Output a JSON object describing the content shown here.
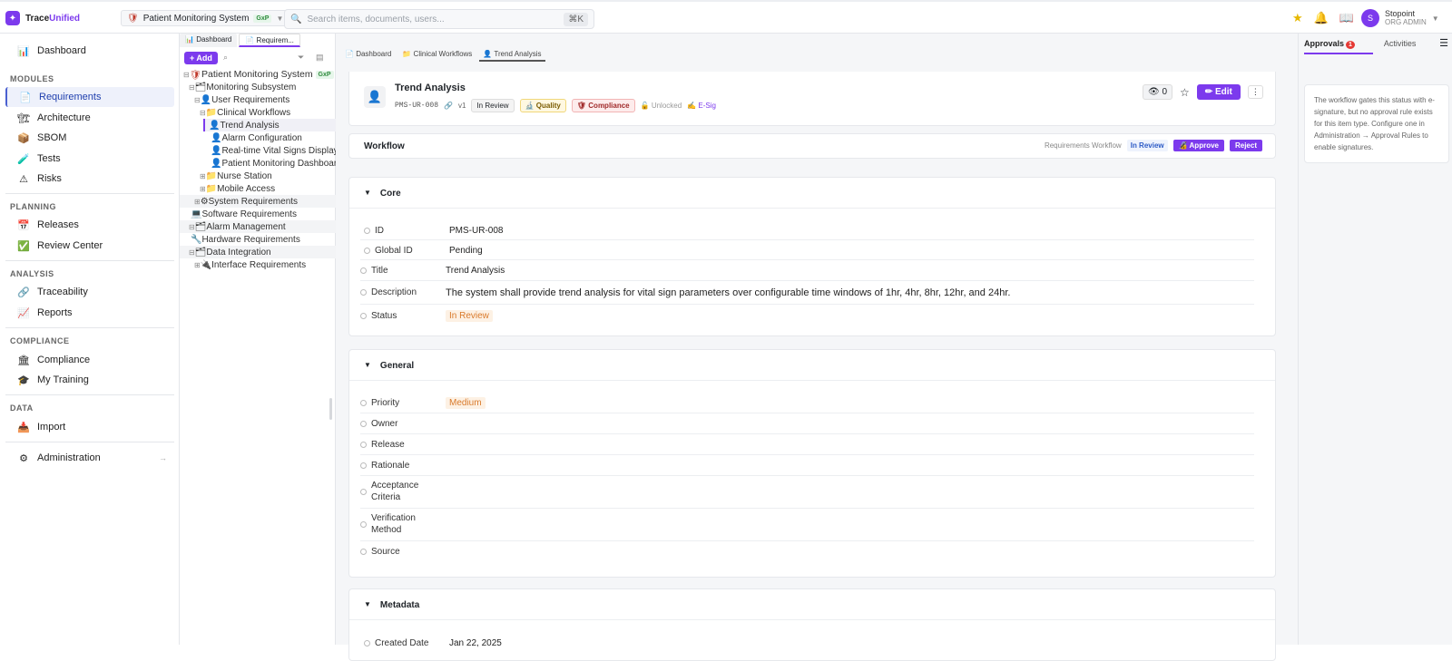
{
  "brand": {
    "name_a": "Trace",
    "name_b": "Unified"
  },
  "project": {
    "name": "Patient Monitoring System",
    "badge": "GxP"
  },
  "search": {
    "placeholder": "Search items, documents, users...",
    "shortcut": "⌘K"
  },
  "user": {
    "initial": "S",
    "name": "Stopoint",
    "role": "ORG ADMIN"
  },
  "sidebar": {
    "dashboard": "Dashboard",
    "modules_title": "MODULES",
    "modules": [
      "Requirements",
      "Architecture",
      "SBOM",
      "Tests",
      "Risks"
    ],
    "planning_title": "PLANNING",
    "planning": [
      "Releases",
      "Review Center"
    ],
    "analysis_title": "ANALYSIS",
    "analysis": [
      "Traceability",
      "Reports"
    ],
    "compliance_title": "COMPLIANCE",
    "compliance": [
      "Compliance",
      "My Training"
    ],
    "data_title": "DATA",
    "data": [
      "Import"
    ],
    "admin": "Administration"
  },
  "tree_tabs": [
    "Dashboard",
    "Requirem..."
  ],
  "tree_add": "+ Add",
  "tree": {
    "root": "Patient Monitoring System",
    "root_badge": "GxP",
    "items": [
      "Monitoring Subsystem",
      "User Requirements",
      "Clinical Workflows",
      "Trend Analysis",
      "Alarm Configuration",
      "Real-time Vital Signs Display",
      "Patient Monitoring Dashboard",
      "Nurse Station",
      "Mobile Access",
      "System Requirements",
      "Software Requirements",
      "Alarm Management",
      "Hardware Requirements",
      "Data Integration",
      "Interface Requirements"
    ]
  },
  "breadcrumbs": [
    "Dashboard",
    "Clinical Workflows",
    "Trend Analysis"
  ],
  "item": {
    "title": "Trend Analysis",
    "id": "PMS-UR-008",
    "version": "v1",
    "status": "In Review",
    "tag_quality": "Quality",
    "tag_compliance": "Compliance",
    "lock": "Unlocked",
    "esig": "E-Sig",
    "watch_count": "0",
    "edit": "Edit"
  },
  "workflow": {
    "title": "Workflow",
    "name": "Requirements Workflow",
    "state": "In Review",
    "approve": "Approve",
    "reject": "Reject"
  },
  "core": {
    "title": "Core",
    "fields": [
      {
        "label": "ID",
        "value": "PMS-UR-008"
      },
      {
        "label": "Global ID",
        "value": "Pending"
      },
      {
        "label": "Title",
        "value": "Trend Analysis"
      },
      {
        "label": "Description",
        "value": "The system shall provide trend analysis for vital sign parameters over configurable time windows of 1hr, 4hr, 8hr, 12hr, and 24hr."
      },
      {
        "label": "Status",
        "value": "In Review"
      }
    ]
  },
  "general": {
    "title": "General",
    "fields": [
      {
        "label": "Priority",
        "value": "Medium"
      },
      {
        "label": "Owner",
        "value": ""
      },
      {
        "label": "Release",
        "value": ""
      },
      {
        "label": "Rationale",
        "value": ""
      },
      {
        "label": "Acceptance Criteria",
        "value": ""
      },
      {
        "label": "Verification Method",
        "value": ""
      },
      {
        "label": "Source",
        "value": ""
      }
    ]
  },
  "metadata": {
    "title": "Metadata",
    "created_label": "Created Date",
    "created_value": "Jan 22, 2025"
  },
  "right": {
    "tab_approvals": "Approvals",
    "approvals_count": "1",
    "tab_activities": "Activities",
    "info": "The workflow gates this status with e-signature, but no approval rule exists for this item type. Configure one in Administration → Approval Rules to enable signatures."
  },
  "colors": {
    "accent": "#7c3aed",
    "status_in_review": "#d97a2b"
  }
}
